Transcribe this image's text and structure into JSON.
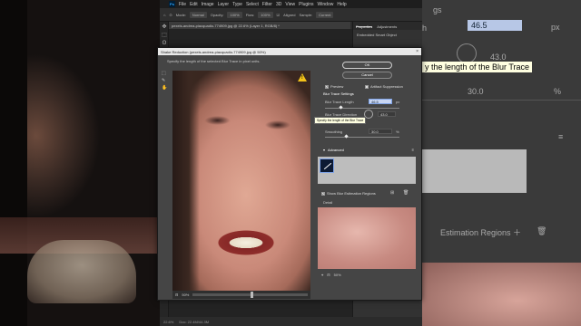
{
  "app": {
    "menu": [
      "File",
      "Edit",
      "Image",
      "Layer",
      "Type",
      "Select",
      "Filter",
      "3D",
      "View",
      "Plugins",
      "Window",
      "Help"
    ],
    "options": {
      "mode_label": "Mode:",
      "mode_value": "Normal",
      "opacity_label": "Opacity:",
      "opacity_value": "100%",
      "flow_label": "Flow:",
      "flow_value": "100%",
      "aligned_label": "Aligned",
      "sample_label": "Sample:",
      "sample_value": "Current"
    },
    "doc_tab": "pexels-andrea-piacquadio-774909.jpg @ 22.6% (Layer 1, RGB/8) *",
    "status_zoom": "22.6%",
    "status_doc": "Doc: 22.4M/44.3M"
  },
  "properties": {
    "tabs": [
      "Properties",
      "Adjustments"
    ],
    "subtitle": "Embedded Smart Object"
  },
  "dialog": {
    "title": "Shake Reduction (pexels-andrea-piacquadio-774909.jpg @ 50%)",
    "hint": "Specify the length of the selected Blur Trace in pixel units.",
    "ok_label": "OK",
    "cancel_label": "Cancel",
    "preview_label": "Preview",
    "artifact_label": "Artifact Suppression",
    "settings_title": "Blur Trace Settings",
    "blur_length_label": "Blur Trace Length",
    "blur_length_value": "46.5",
    "blur_length_unit": "px",
    "blur_direction_label": "Blur Trace Direction",
    "blur_direction_value": "43.0",
    "smoothing_label": "Smoothing",
    "smoothing_value": "30.0",
    "smoothing_unit": "%",
    "tooltip": "Specify the length of the Blur Trace",
    "advanced_label": "Advanced",
    "show_regions_label": "Show Blur Estimation Regions",
    "detail_label": "Detail",
    "preview_zoom": "50%",
    "detail_zoom": "50%",
    "warning_icon": "warning-icon",
    "colors": {
      "accent": "#31a8ff",
      "warning": "#f3c21a",
      "highlight_field": "#c9d6f2"
    }
  },
  "background_right": {
    "length_value": "46.5",
    "length_unit": "px",
    "direction_value": "43.0",
    "smoothing_value": "30.0",
    "smoothing_unit": "%",
    "tooltip": "y the length of the Blur Trace",
    "regions_text": "Estimation Regions",
    "top_text": "gs",
    "side_label": "h"
  }
}
